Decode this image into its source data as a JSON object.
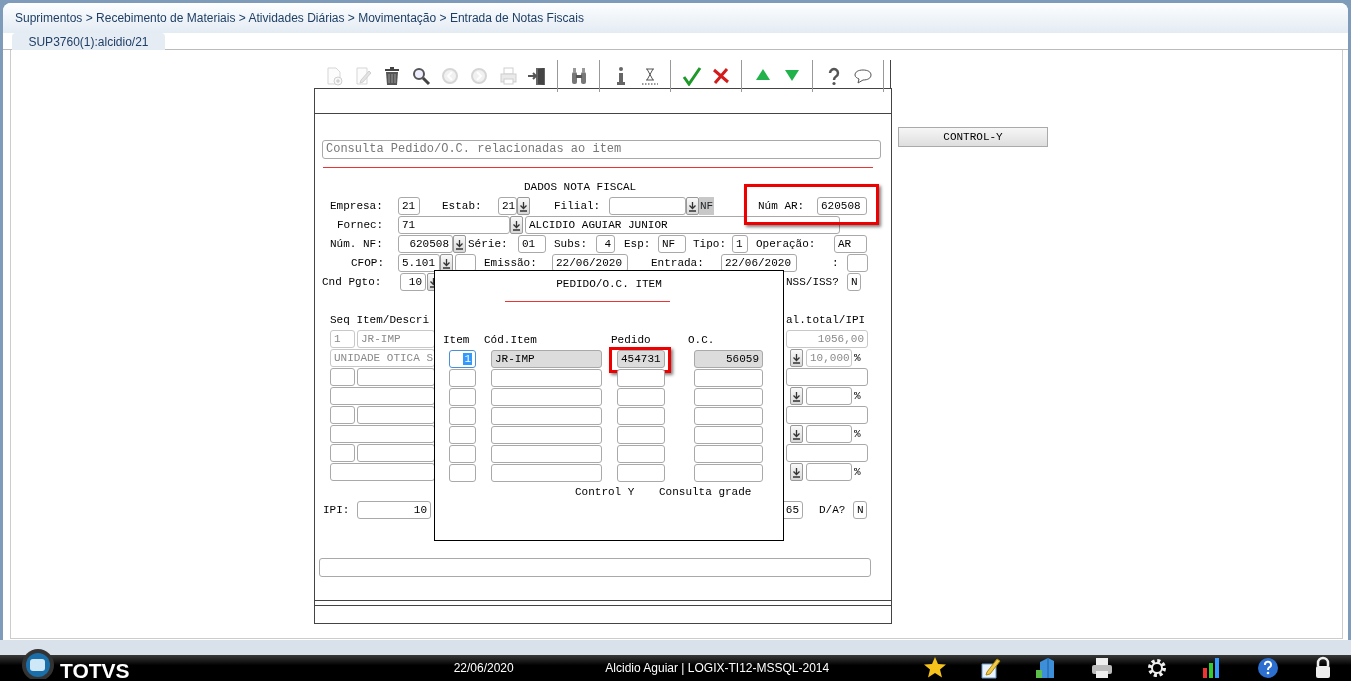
{
  "breadcrumb": "Suprimentos > Recebimento de Materiais > Atividades Diárias > Movimentação > Entrada de Notas Fiscais",
  "tabs": [
    {
      "label": "SUP3760(1):alcidio/21",
      "selected": true
    }
  ],
  "toolbar": [
    {
      "kind": "new",
      "disabled": true
    },
    {
      "kind": "edit",
      "disabled": true
    },
    {
      "kind": "delete",
      "disabled": false
    },
    {
      "kind": "search",
      "disabled": false
    },
    {
      "kind": "previous",
      "disabled": true
    },
    {
      "kind": "next",
      "disabled": true
    },
    {
      "kind": "print",
      "disabled": true
    },
    {
      "kind": "exit",
      "disabled": false
    },
    {
      "kind": "separator"
    },
    {
      "kind": "binoculars",
      "disabled": false
    },
    {
      "kind": "separator"
    },
    {
      "kind": "info",
      "disabled": false
    },
    {
      "kind": "hourglass",
      "disabled": false
    },
    {
      "kind": "separator"
    },
    {
      "kind": "confirm",
      "disabled": false
    },
    {
      "kind": "cancel",
      "disabled": false
    },
    {
      "kind": "separator"
    },
    {
      "kind": "up",
      "disabled": false
    },
    {
      "kind": "down",
      "disabled": false
    },
    {
      "kind": "separator"
    },
    {
      "kind": "help",
      "disabled": false
    },
    {
      "kind": "comment",
      "disabled": false
    },
    {
      "kind": "separator"
    }
  ],
  "message": "Consulta Pedido/O.C. relacionadas ao item",
  "form": {
    "title": "DADOS NOTA FISCAL",
    "items": [
      {
        "kind": "label",
        "text": "Empresa:"
      },
      {
        "kind": "field",
        "value": "21"
      },
      {
        "kind": "label",
        "text": "Estab:"
      },
      {
        "kind": "field",
        "value": "21"
      },
      {
        "kind": "lookup"
      },
      {
        "kind": "label",
        "text": "Filial:"
      },
      {
        "kind": "field"
      },
      {
        "kind": "lookup"
      },
      {
        "kind": "tag",
        "text": "NF"
      },
      {
        "kind": "label",
        "text": "Núm AR:",
        "highlighted": true
      },
      {
        "kind": "field",
        "value": "620508",
        "highlighted": true
      },
      {
        "kind": "label",
        "text": "Fornec:"
      },
      {
        "kind": "field",
        "value": "71"
      },
      {
        "kind": "lookup"
      },
      {
        "kind": "field",
        "value": "ALCIDIO AGUIAR JUNIOR"
      },
      {
        "kind": "label",
        "text": "Núm. NF:"
      },
      {
        "kind": "field",
        "value": "620508"
      },
      {
        "kind": "lookup"
      },
      {
        "kind": "label",
        "text": "Série:"
      },
      {
        "kind": "field",
        "value": "01"
      },
      {
        "kind": "label",
        "text": "Subs:"
      },
      {
        "kind": "field",
        "value": "4"
      },
      {
        "kind": "label",
        "text": "Esp:"
      },
      {
        "kind": "field",
        "value": "NF"
      },
      {
        "kind": "label",
        "text": "Tipo:"
      },
      {
        "kind": "field",
        "value": "1"
      },
      {
        "kind": "label",
        "text": "Operação:"
      },
      {
        "kind": "field",
        "value": "AR"
      },
      {
        "kind": "label",
        "text": "CFOP:"
      },
      {
        "kind": "field",
        "value": "5.101"
      },
      {
        "kind": "lookup"
      },
      {
        "kind": "field"
      },
      {
        "kind": "label",
        "text": "Emissão:"
      },
      {
        "kind": "field",
        "value": "22/06/2020"
      },
      {
        "kind": "label",
        "text": "Entrada:"
      },
      {
        "kind": "field",
        "value": "22/06/2020"
      },
      {
        "kind": "label",
        "text": ":"
      },
      {
        "kind": "field"
      },
      {
        "kind": "label",
        "text": "Cnd Pgto:"
      },
      {
        "kind": "field",
        "value": "10"
      },
      {
        "kind": "lookup"
      },
      {
        "kind": "label",
        "text": "NSS/ISS?"
      },
      {
        "kind": "field",
        "value": "N"
      },
      {
        "kind": "label",
        "text": "IPI:"
      },
      {
        "kind": "field",
        "value": "10"
      },
      {
        "kind": "field",
        "value": "65"
      },
      {
        "kind": "label",
        "text": "D/A?"
      },
      {
        "kind": "field",
        "value": "N"
      }
    ]
  },
  "grid": {
    "header": [
      "Seq Item/Descri",
      "al.total/IPI"
    ],
    "rows": [
      {
        "kind": "item",
        "seq": "1",
        "name": "JR-IMP",
        "total": "1056,00",
        "disabled": true
      },
      {
        "kind": "detail",
        "description": "UNIDADE OTICA S",
        "ipi": "10,000",
        "percent": "%",
        "disabled": true
      },
      {
        "kind": "item",
        "disabled": false
      },
      {
        "kind": "detail",
        "percent": "%",
        "disabled": false
      },
      {
        "kind": "item",
        "disabled": false
      },
      {
        "kind": "detail",
        "percent": "%",
        "disabled": false
      },
      {
        "kind": "item",
        "disabled": false
      },
      {
        "kind": "detail",
        "percent": "%",
        "disabled": false
      }
    ]
  },
  "popup": {
    "title": "PEDIDO/O.C. ITEM",
    "columns": [
      "Item",
      "Cód.Item",
      "Pedido",
      "O.C."
    ],
    "rows": [
      {
        "item": "1",
        "code": "JR-IMP",
        "order": "454731",
        "oc": "56059",
        "selected": true,
        "highlighted": true
      },
      {
        "selected": false,
        "highlighted": false
      },
      {
        "selected": false,
        "highlighted": false
      },
      {
        "selected": false,
        "highlighted": false
      },
      {
        "selected": false,
        "highlighted": false
      },
      {
        "selected": false,
        "highlighted": false
      },
      {
        "selected": false,
        "highlighted": false
      }
    ],
    "footer": [
      "Control Y",
      "Consulta grade"
    ]
  },
  "side_button": "CONTROL-Y",
  "taskbar": {
    "logo": "TOTVS",
    "date": "22/06/2020",
    "session": "Alcidio Aguiar | LOGIX-TI12-MSSQL-2014"
  }
}
